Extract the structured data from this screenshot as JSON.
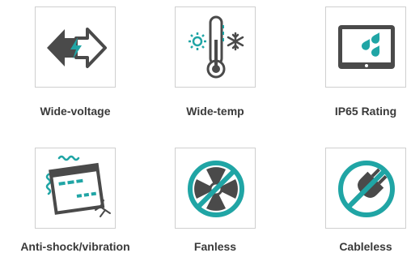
{
  "colors": {
    "teal": "#20a5a5",
    "dark": "#4a4a4a",
    "border": "#cfcfcf"
  },
  "features": [
    {
      "label": "Wide-voltage",
      "icon": "double-arrow-lightning-icon"
    },
    {
      "label": "Wide-temp",
      "icon": "thermometer-sun-snowflake-icon"
    },
    {
      "label": "IP65 Rating",
      "icon": "tablet-water-drops-icon"
    },
    {
      "label": "Anti-shock/vibration",
      "icon": "device-vibration-crack-icon"
    },
    {
      "label": "Fanless",
      "icon": "no-fan-icon"
    },
    {
      "label": "Cableless",
      "icon": "no-plug-icon"
    }
  ]
}
